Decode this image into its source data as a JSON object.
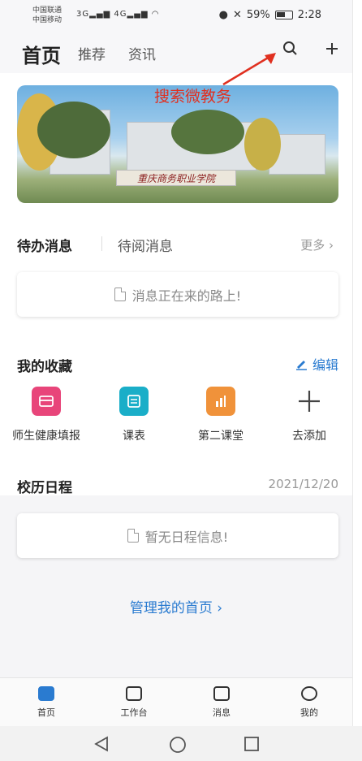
{
  "status_bar": {
    "carrier1": "中国联通",
    "carrier2": "中国移动",
    "net1": "3G",
    "net2": "4G",
    "battery_pct": "59%",
    "time": "2:28"
  },
  "header": {
    "tab_home": "首页",
    "tab_recommend": "推荐",
    "tab_news": "资讯"
  },
  "annotation": "搜索微教务",
  "banner": {
    "sign_text": "重庆商务职业学院"
  },
  "messages": {
    "tab_pending": "待办消息",
    "tab_unread": "待阅消息",
    "more": "更多",
    "empty_text": "消息正在来的路上!"
  },
  "favorites": {
    "title": "我的收藏",
    "edit": "编辑",
    "items": [
      {
        "label": "师生健康填报",
        "color": "#e8457a"
      },
      {
        "label": "课表",
        "color": "#1aaec8"
      },
      {
        "label": "第二课堂",
        "color": "#f0923a"
      },
      {
        "label": "去添加",
        "color": "#ffffff"
      }
    ]
  },
  "calendar": {
    "title": "校历日程",
    "date": "2021/12/20",
    "empty_text": "暂无日程信息!"
  },
  "manage_home": "管理我的首页",
  "tabbar": {
    "items": [
      {
        "label": "首页",
        "icon": "home-icon"
      },
      {
        "label": "工作台",
        "icon": "workbench-icon"
      },
      {
        "label": "消息",
        "icon": "message-icon"
      },
      {
        "label": "我的",
        "icon": "profile-icon"
      }
    ]
  },
  "colors": {
    "accent": "#2a7bd0",
    "annotation": "#e03020"
  }
}
